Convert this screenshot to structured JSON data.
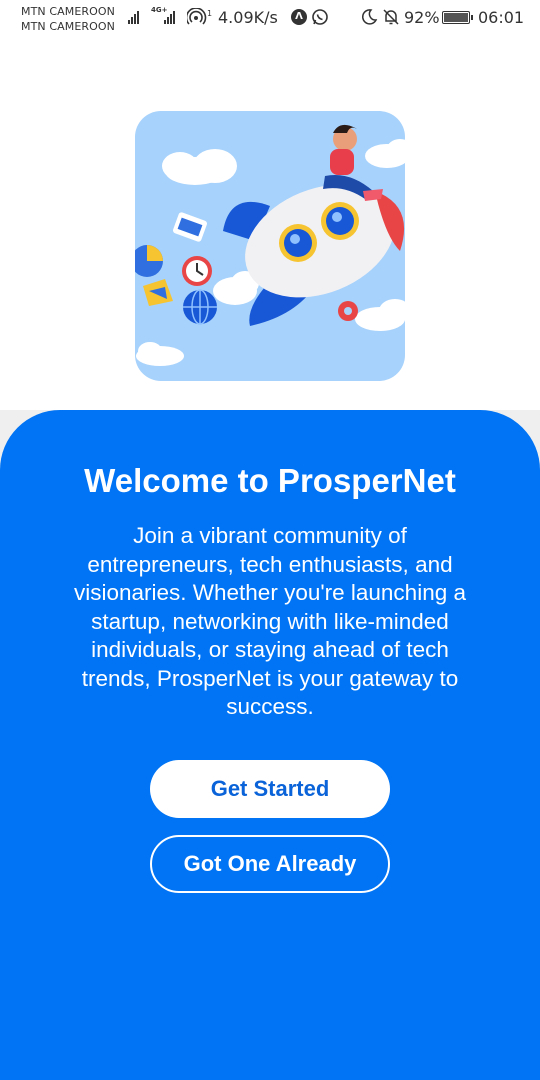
{
  "status_bar": {
    "carrier_1": "MTN CAMEROON",
    "carrier_2": "MTN CAMEROON",
    "network_type": "4G+",
    "network_speed": "4.09K/s",
    "battery_percent": "92%",
    "battery_level": 0.92,
    "time": "06:01",
    "icons": [
      "signal-icon",
      "signal-4g-icon",
      "hotspot-icon",
      "app-a-icon",
      "whatsapp-icon",
      "moon-icon",
      "bell-off-icon",
      "battery-icon"
    ]
  },
  "hero": {
    "illustration": "woman-riding-rocket-illustration",
    "background_color": "#a7d2fb"
  },
  "welcome": {
    "title": "Welcome to ProsperNet",
    "body": "Join a vibrant community of entrepreneurs, tech enthusiasts, and visionaries. Whether you're launching a startup, networking with like-minded individuals, or staying ahead of tech trends, ProsperNet is your gateway to success."
  },
  "actions": {
    "primary_label": "Get Started",
    "secondary_label": "Got One Already"
  },
  "colors": {
    "panel": "#0074f4",
    "primary_button_text": "#0a63d8",
    "background_strip": "#efefef"
  }
}
